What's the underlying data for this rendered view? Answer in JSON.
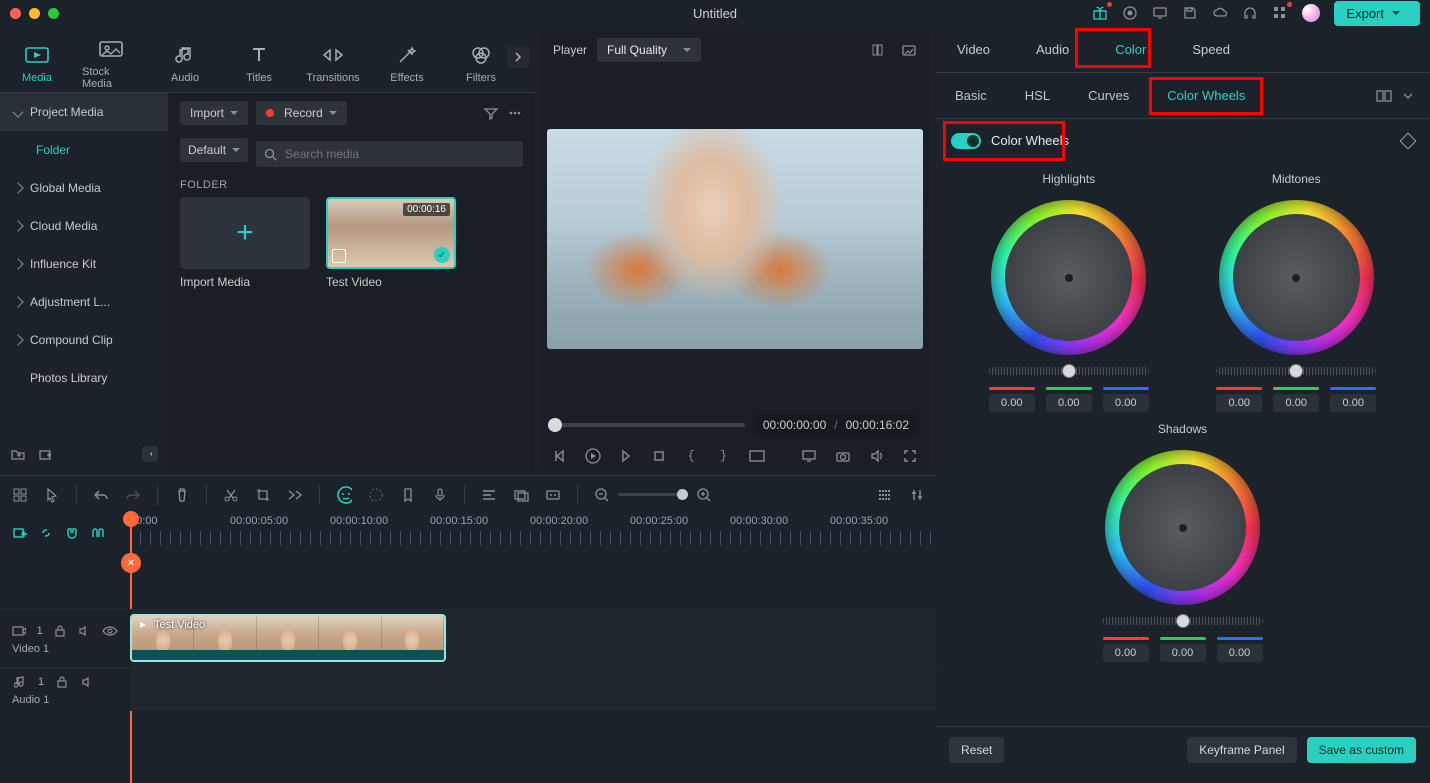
{
  "title": "Untitled",
  "topbar": {
    "export": "Export"
  },
  "tabs": [
    {
      "label": "Media",
      "active": true
    },
    {
      "label": "Stock Media"
    },
    {
      "label": "Audio"
    },
    {
      "label": "Titles"
    },
    {
      "label": "Transitions"
    },
    {
      "label": "Effects"
    },
    {
      "label": "Filters"
    }
  ],
  "tree": {
    "project": "Project Media",
    "folder": "Folder",
    "items": [
      "Global Media",
      "Cloud Media",
      "Influence Kit",
      "Adjustment L...",
      "Compound Clip",
      "Photos Library"
    ]
  },
  "media": {
    "import": "Import",
    "record": "Record",
    "default": "Default",
    "search_placeholder": "Search media",
    "section": "FOLDER",
    "importMedia": "Import Media",
    "testVideo": "Test Video",
    "duration": "00:00:16"
  },
  "player": {
    "label": "Player",
    "quality": "Full Quality",
    "current": "00:00:00:00",
    "total": "00:00:16:02"
  },
  "timeline": {
    "marks": [
      "00:00",
      "00:00:05:00",
      "00:00:10:00",
      "00:00:15:00",
      "00:00:20:00",
      "00:00:25:00",
      "00:00:30:00",
      "00:00:35:00"
    ],
    "video_track": "Video 1",
    "audio_track": "Audio 1",
    "track_count": "1",
    "clip_name": "Test Video"
  },
  "right": {
    "tabs": [
      "Video",
      "Audio",
      "Color",
      "Speed"
    ],
    "subtabs": [
      "Basic",
      "HSL",
      "Curves",
      "Color Wheels"
    ],
    "section": "Color Wheels",
    "wheels": {
      "highlights": "Highlights",
      "midtones": "Midtones",
      "shadows": "Shadows",
      "val": "0.00"
    },
    "footer": {
      "reset": "Reset",
      "keyframe": "Keyframe Panel",
      "save": "Save as custom"
    }
  }
}
